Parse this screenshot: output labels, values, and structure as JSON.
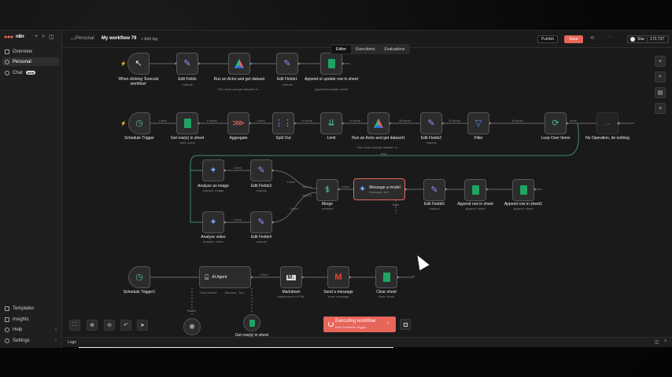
{
  "app": {
    "brand": "n8n",
    "chat_badge": "beta"
  },
  "sidebar": {
    "items": [
      {
        "label": "Overview"
      },
      {
        "label": "Personal"
      },
      {
        "label": "Chat"
      }
    ],
    "bottom": [
      {
        "label": "Templates"
      },
      {
        "label": "Insights"
      },
      {
        "label": "Help"
      },
      {
        "label": "Settings"
      }
    ]
  },
  "header": {
    "breadcrumb": "Personal",
    "title": "My workflow 79",
    "add_tag": "+ Add tag",
    "publish": "Publish",
    "save": "Save",
    "star": "Star",
    "stars": "172,737"
  },
  "tabs": [
    {
      "label": "Editor"
    },
    {
      "label": "Executions"
    },
    {
      "label": "Evaluations"
    }
  ],
  "nodes": {
    "exec_wf": {
      "label": "When clicking 'Execute workflow'"
    },
    "edit_fields": {
      "label": "Edit Fields",
      "sub": "manual"
    },
    "run_actor": {
      "label": "Run an Actor and get dataset",
      "sub": "Run actor and get dataset: A..."
    },
    "edit_fields1": {
      "label": "Edit Fields1",
      "sub": "manual"
    },
    "append_update": {
      "label": "Append or update row in sheet",
      "sub": "appendOrUpdate: sheet"
    },
    "schedule": {
      "label": "Schedule Trigger"
    },
    "get_rows": {
      "label": "Get row(s) in sheet",
      "sub": "read: sheet"
    },
    "aggregate": {
      "label": "Aggregate"
    },
    "split_out": {
      "label": "Split Out"
    },
    "limit": {
      "label": "Limit"
    },
    "run_actor1": {
      "label": "Run an Actor and get dataset1",
      "sub": "Run actor and get dataset: A..."
    },
    "edit_fields2": {
      "label": "Edit Fields2",
      "sub": "manual"
    },
    "filter": {
      "label": "Filter"
    },
    "loop": {
      "label": "Loop Over Items"
    },
    "noop": {
      "label": "No Operation, do nothing"
    },
    "analyze_image": {
      "label": "Analyze an image",
      "sub": "analyze: image"
    },
    "edit_fields3": {
      "label": "Edit Fields3",
      "sub": "manual"
    },
    "merge": {
      "label": "Merge",
      "sub": "combine"
    },
    "message": {
      "label": "Message a model",
      "sub": "message: text"
    },
    "edit_fields5": {
      "label": "Edit Fields5",
      "sub": "manual"
    },
    "append_row": {
      "label": "Append row in sheet",
      "sub": "append: sheet"
    },
    "append_row1": {
      "label": "Append row in sheet1",
      "sub": "append: sheet"
    },
    "analyze_video": {
      "label": "Analyze video",
      "sub": "analyze: video"
    },
    "edit_fields4": {
      "label": "Edit Fields4",
      "sub": "manual"
    },
    "schedule1": {
      "label": "Schedule Trigger1"
    },
    "ai_agent": {
      "label": "AI Agent",
      "chat": "Chat Model*",
      "memory": "Memory",
      "tool": "Tool"
    },
    "markdown": {
      "label": "Markdown",
      "sub": "Markdown to HTML"
    },
    "send_msg": {
      "label": "Send a message",
      "sub": "send: message"
    },
    "clear_sheet": {
      "label": "Clear sheet",
      "sub": "clear: sheet"
    },
    "model": {
      "label": "Model"
    },
    "get_rows1": {
      "label": "Get row(s) in sheet"
    }
  },
  "edge_labels": {
    "e1": "1 item",
    "e2": "6 items",
    "e3": "1 item",
    "e4": "6 items",
    "e5": "6 items",
    "e6": "30 items",
    "e7": "30 items",
    "e8": "16 items",
    "e9": "done",
    "e10": "loop",
    "e11": "1 item",
    "e12": "1 item",
    "e13": "1 item",
    "e14": "1 item",
    "e15": "Input 1",
    "e16": "Input 2",
    "e17": "1 item",
    "e18": "Tools",
    "e19": "1 item"
  },
  "execution": {
    "title": "Executing workflow",
    "sub": "from Schedule Trigger"
  },
  "logs": {
    "label": "Logs"
  },
  "colors": {
    "accent": "#e8655a",
    "canvas": "#1a1a1a",
    "node": "#2c2c2c",
    "edge": "#6a6a6a",
    "loop": "#3f8f6a"
  }
}
